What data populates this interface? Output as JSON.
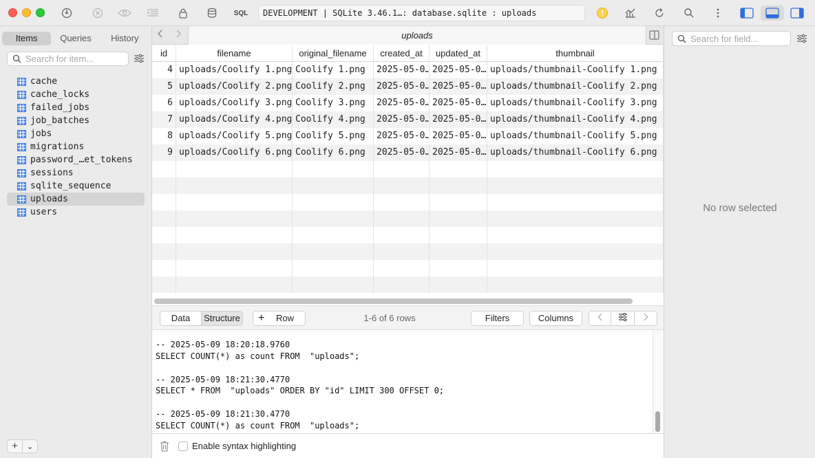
{
  "titlebar": {
    "sql_label": "SQL",
    "connection": "DEVELOPMENT | SQLite 3.46.1…: database.sqlite : uploads"
  },
  "sidebar": {
    "tabs": [
      "Items",
      "Queries",
      "History"
    ],
    "search_placeholder": "Search for item...",
    "tables": [
      "cache",
      "cache_locks",
      "failed_jobs",
      "job_batches",
      "jobs",
      "migrations",
      "password_…et_tokens",
      "sessions",
      "sqlite_sequence",
      "uploads",
      "users"
    ],
    "selected_table": "uploads",
    "add_label": "+",
    "menu_label": "⌄"
  },
  "main": {
    "tab_title": "uploads",
    "columns": [
      "id",
      "filename",
      "original_filename",
      "created_at",
      "updated_at",
      "thumbnail"
    ],
    "rows": [
      [
        "4",
        "uploads/Coolify 1.png",
        "Coolify 1.png",
        "2025-05-0…",
        "2025-05-0…",
        "uploads/thumbnail-Coolify 1.png"
      ],
      [
        "5",
        "uploads/Coolify 2.png",
        "Coolify 2.png",
        "2025-05-0…",
        "2025-05-0…",
        "uploads/thumbnail-Coolify 2.png"
      ],
      [
        "6",
        "uploads/Coolify 3.png",
        "Coolify 3.png",
        "2025-05-0…",
        "2025-05-0…",
        "uploads/thumbnail-Coolify 3.png"
      ],
      [
        "7",
        "uploads/Coolify 4.png",
        "Coolify 4.png",
        "2025-05-0…",
        "2025-05-0…",
        "uploads/thumbnail-Coolify 4.png"
      ],
      [
        "8",
        "uploads/Coolify 5.png",
        "Coolify 5.png",
        "2025-05-0…",
        "2025-05-0…",
        "uploads/thumbnail-Coolify 5.png"
      ],
      [
        "9",
        "uploads/Coolify 6.png",
        "Coolify 6.png",
        "2025-05-0…",
        "2025-05-0…",
        "uploads/thumbnail-Coolify 6.png"
      ]
    ],
    "toolbar": {
      "data_label": "Data",
      "structure_label": "Structure",
      "row_label": "Row",
      "row_count": "1-6 of 6 rows",
      "filters_label": "Filters",
      "columns_label": "Columns"
    },
    "log_lines": [
      "-- 2025-05-09 18:20:18.9760",
      "SELECT COUNT(*) as count FROM  \"uploads\";",
      "",
      "-- 2025-05-09 18:21:30.4770",
      "SELECT * FROM  \"uploads\" ORDER BY \"id\" LIMIT 300 OFFSET 0;",
      "",
      "-- 2025-05-09 18:21:30.4770",
      "SELECT COUNT(*) as count FROM  \"uploads\";"
    ],
    "syntax_label": "Enable syntax highlighting"
  },
  "right_panel": {
    "search_placeholder": "Search for field...",
    "empty_text": "No row selected"
  }
}
